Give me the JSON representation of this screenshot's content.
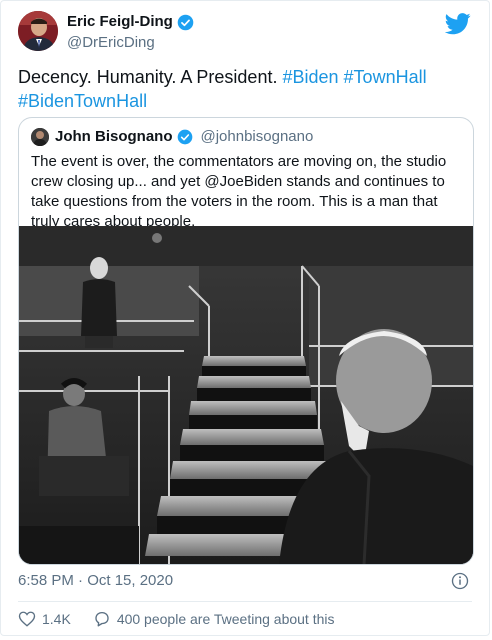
{
  "author": {
    "name": "Eric Feigl-Ding",
    "handle": "@DrEricDing"
  },
  "tweet": {
    "text_plain": "Decency. Humanity. A President.",
    "hashtags": [
      "#Biden",
      "#TownHall",
      "#BidenTownHall"
    ]
  },
  "quoted": {
    "name": "John Bisognano",
    "handle": "@johnbisognano",
    "text": "The event is over, the commentators are moving on, the studio crew closing up... and yet @JoeBiden stands and continues to take questions from the voters in the room. This is a man that truly cares about people."
  },
  "meta": {
    "timestamp": "6:58 PM · Oct 15, 2020"
  },
  "actions": {
    "likes": "1.4K",
    "tweeting_text": "400 people are Tweeting about this"
  },
  "colors": {
    "link": "#1b95e0",
    "secondary_text": "#5b7083",
    "twitter_blue": "#1da1f2"
  },
  "icons": {
    "verified": "verified-badge-icon",
    "logo": "twitter-bird-icon",
    "info": "info-icon",
    "like": "heart-icon",
    "reply": "speech-bubble-icon"
  }
}
